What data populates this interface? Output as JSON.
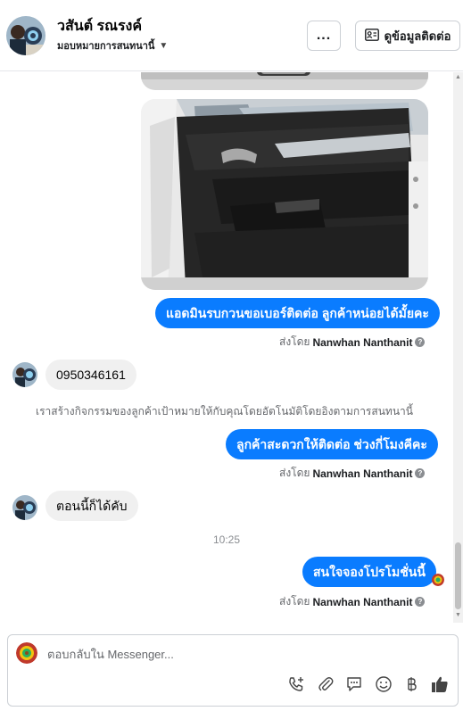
{
  "header": {
    "contact_name": "วสันต์ รณรงค์",
    "assign_label": "มอบหมายการสนทนานี้",
    "more_label": "...",
    "view_contact_label": "ดูข้อมูลติดต่อ"
  },
  "messages": {
    "out1": "แอดมินรบกวนขอเบอร์ติดต่อ ลูกค้าหน่อยได้มั้ยคะ",
    "in1": "0950346161",
    "system_note": "เราสร้างกิจกรรมของลูกค้าเป้าหมายให้กับคุณโดยอัตโนมัติโดยอิงตามการสนทนานี้",
    "out2": "ลูกค้าสะดวกให้ติดต่อ ช่วงกี่โมงคีคะ",
    "in2": "ตอนนี้ก็ได้คับ",
    "timestamp": "10:25",
    "out3": "สนใจจองโปรโมชั่นนี้"
  },
  "sent_by": {
    "prefix": "ส่งโดย",
    "name": "Nanwhan Nanthanit"
  },
  "composer": {
    "placeholder": "ตอบกลับใน Messenger..."
  },
  "icons": {
    "more": "more-dots-icon",
    "contact": "contact-card-icon",
    "call": "phone-plus-icon",
    "attach": "paperclip-icon",
    "saved_reply": "chat-bubble-icon",
    "emoji": "emoji-icon",
    "currency": "baht-icon",
    "like": "thumbs-up-icon"
  },
  "colors": {
    "accent": "#0a7cff",
    "incoming_bubble": "#f0f0f0",
    "muted_text": "#65676b"
  }
}
